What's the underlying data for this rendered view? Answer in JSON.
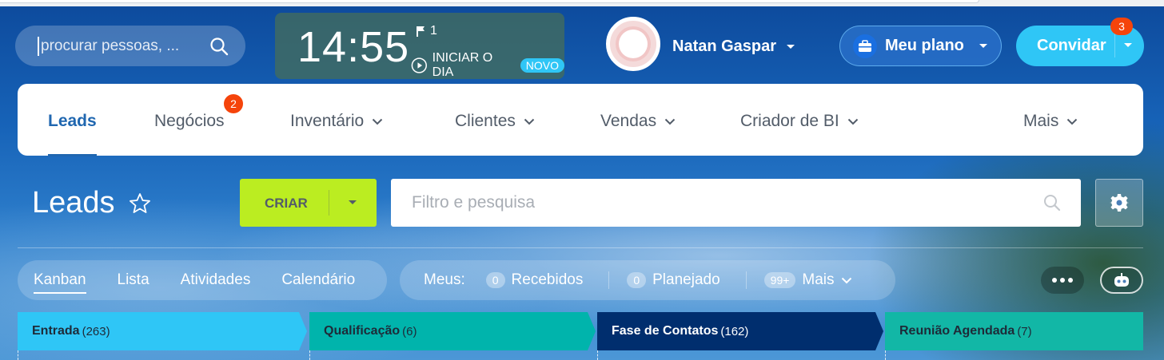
{
  "topbar": {
    "search_placeholder": "procurar pessoas, ...",
    "clock": {
      "time": "14:55",
      "flag_count": "1",
      "start_label": "INICIAR O DIA",
      "new_badge": "NOVO"
    },
    "user_name": "Natan Gaspar",
    "plan_label": "Meu plano",
    "invite_label": "Convidar",
    "invite_badge": "3"
  },
  "nav": {
    "items": [
      {
        "label": "Leads",
        "active": true
      },
      {
        "label": "Negócios",
        "badge": "2"
      },
      {
        "label": "Inventário",
        "dropdown": true
      },
      {
        "label": "Clientes",
        "dropdown": true
      },
      {
        "label": "Vendas",
        "dropdown": true
      },
      {
        "label": "Criador de BI",
        "dropdown": true
      },
      {
        "label": "Mais",
        "dropdown": true
      }
    ]
  },
  "page": {
    "title": "Leads",
    "create_label": "CRIAR",
    "filter_placeholder": "Filtro e pesquisa"
  },
  "views": {
    "items": [
      "Kanban",
      "Lista",
      "Atividades",
      "Calendário"
    ],
    "active": "Kanban"
  },
  "counters": {
    "label": "Meus:",
    "items": [
      {
        "count": "0",
        "label": "Recebidos"
      },
      {
        "count": "0",
        "label": "Planejado"
      },
      {
        "count": "99+",
        "label": "Mais"
      }
    ]
  },
  "stages": [
    {
      "name": "Entrada",
      "count": "(263)",
      "color": "#2fc6f6",
      "text_color": "#1e2a38"
    },
    {
      "name": "Qualificação",
      "count": "(6)",
      "color": "#00b4ac",
      "text_color": "#1e2a38"
    },
    {
      "name": "Fase de Contatos",
      "count": "(162)",
      "color": "#002e6e",
      "text_color": "#ffffff"
    },
    {
      "name": "Reunião Agendada",
      "count": "(7)",
      "color": "#12b7a6",
      "text_color": "#1e2a38"
    }
  ],
  "colors": {
    "accent_blue": "#2067b0",
    "create_green": "#bbed21",
    "invite_cyan": "#2fc6f6",
    "badge_red": "#f5440b"
  }
}
